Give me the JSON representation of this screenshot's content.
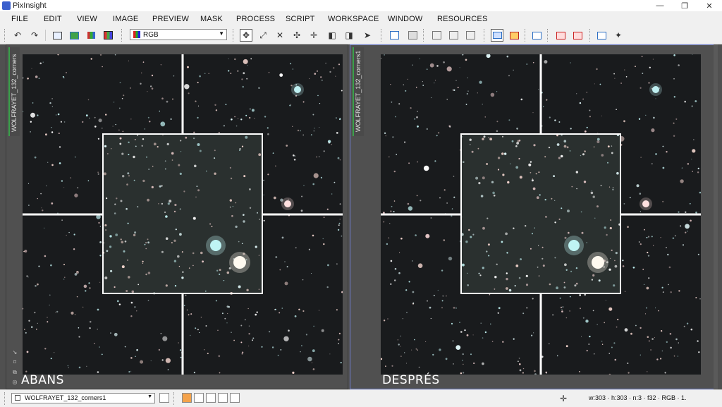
{
  "window": {
    "title": "PixInsight",
    "controls": [
      "—",
      "❐",
      "✕"
    ]
  },
  "menu": [
    "FILE",
    "EDIT",
    "VIEW",
    "IMAGE",
    "PREVIEW",
    "MASK",
    "PROCESS",
    "SCRIPT",
    "WORKSPACE",
    "WINDOW",
    "RESOURCES"
  ],
  "toolbar": {
    "channel_combo": "RGB",
    "icons": [
      "undo-icon",
      "redo-icon",
      "new-image-icon",
      "duplicate-image-icon",
      "extract-channels-icon",
      "combine-channels-icon",
      "pan-mode-icon",
      "zoom-in-mode-icon",
      "zoom-out-mode-icon",
      "zoom-fit-icon",
      "center-view-icon",
      "readout-icon",
      "ruler-icon",
      "cursor-icon"
    ]
  },
  "views": [
    {
      "id": "WOLFRAYET_132_corners",
      "caption": "ABANS",
      "active": false
    },
    {
      "id": "WOLFRAYET_132_corners1",
      "caption": "DESPRÉS",
      "active": true
    }
  ],
  "status": {
    "view_combo": "WOLFRAYET_132_corners1",
    "info": "w:303 · h:303 · n:3 · f32 · RGB · 1.",
    "swatch_colors": [
      "#f4a24a",
      "#ffffff",
      "#ffffff",
      "#ffffff",
      "#ffffff",
      "#ffffff"
    ]
  },
  "colors": {
    "workspace": "#505050",
    "image_bg": "#191b1d",
    "active_frame": "#6f7fd0",
    "separator": "#ffffff"
  }
}
